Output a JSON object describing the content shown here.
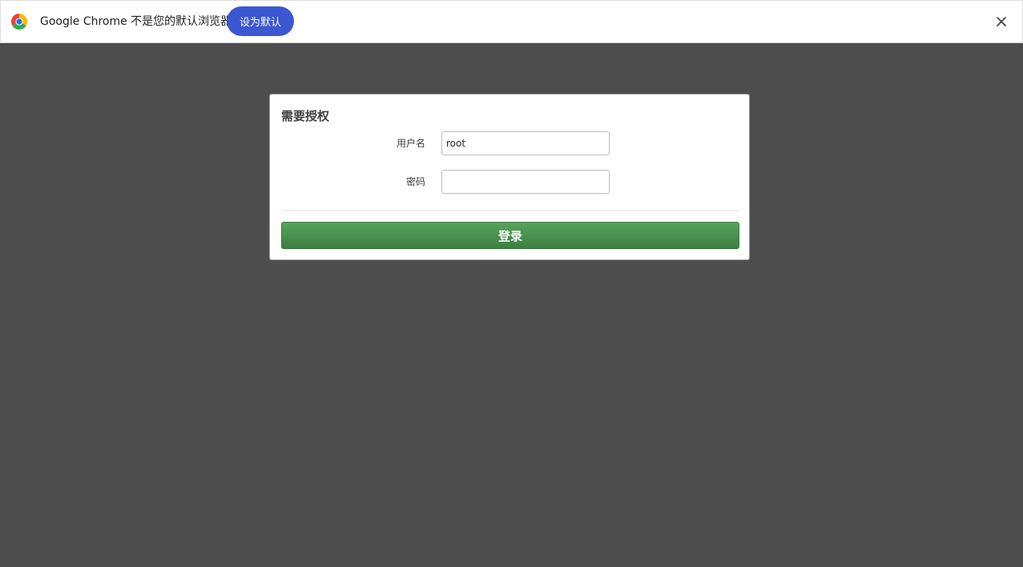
{
  "infobar": {
    "message": "Google Chrome 不是您的默认浏览器",
    "set_default_label": "设为默认",
    "icons": {
      "logo": "chrome-logo-icon",
      "close": "close-icon"
    }
  },
  "login": {
    "title": "需要授权",
    "username_label": "用户名",
    "username_value": "root",
    "password_label": "密码",
    "password_value": "",
    "submit_label": "登录"
  },
  "colors": {
    "background": "#4d4d4d",
    "infobar_button": "#3b57d1",
    "login_button_top": "#58a45c",
    "login_button_bottom": "#3c7e40"
  }
}
